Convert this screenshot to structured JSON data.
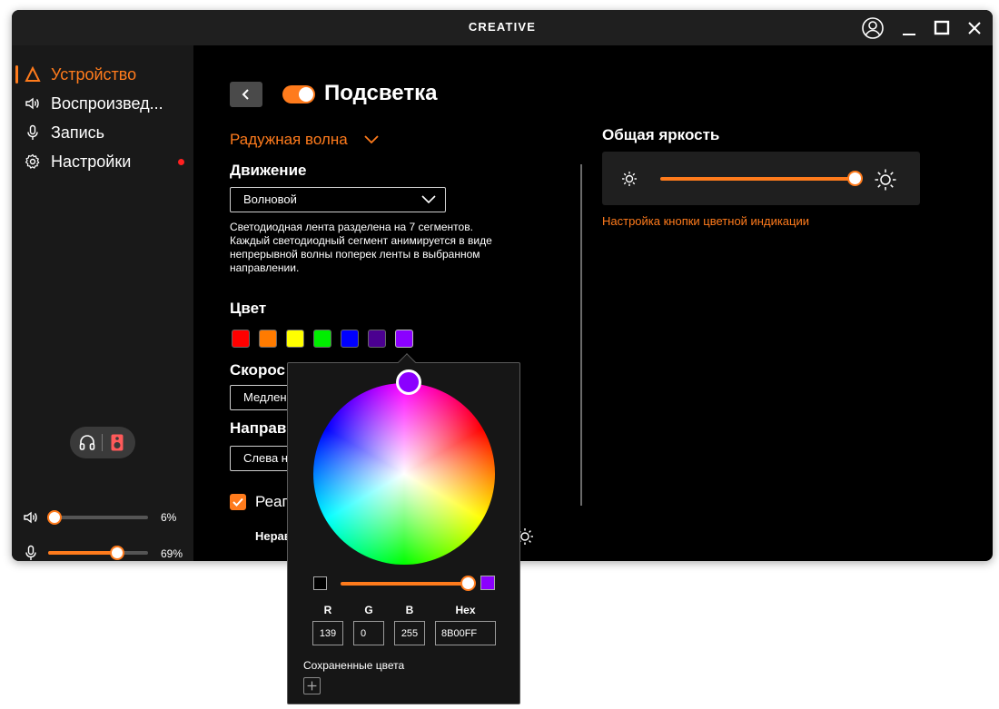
{
  "app": {
    "brand": "CREATIVE"
  },
  "sidebar": {
    "items": [
      {
        "label": "Устройство",
        "icon": "device-icon",
        "active": true
      },
      {
        "label": "Воспроизвед...",
        "icon": "speaker-icon",
        "active": false
      },
      {
        "label": "Запись",
        "icon": "microphone-icon",
        "active": false
      },
      {
        "label": "Настройки",
        "icon": "gear-icon",
        "active": false,
        "notification": true
      }
    ],
    "volume": {
      "value_label": "6%",
      "level": 0.06
    },
    "mic": {
      "value_label": "69%",
      "level": 0.69
    }
  },
  "main": {
    "title": "Подсветка",
    "lighting_enabled": true,
    "effect": "Радужная волна",
    "motion_label": "Движение",
    "motion_value": "Волновой",
    "description": "Светодиодная лента разделена на 7 сегментов. Каждый светодиодный сегмент анимируется в виде непрерывной волны поперек ленты в выбранном направлении.",
    "color_label": "Цвет",
    "colors": [
      "#ff0000",
      "#ff7b00",
      "#ffff00",
      "#00ee00",
      "#0000ff",
      "#4b0090",
      "#8b00ff"
    ],
    "speed_label": "Скорос",
    "speed_value": "Медлен",
    "direction_label": "Направ",
    "direction_value": "Слева н",
    "checkbox_label": "Реаг",
    "checkbox_checked": true,
    "small_label": "Нерав"
  },
  "brightness": {
    "title": "Общая яркость",
    "level": 1.0,
    "link": "Настройка кнопки цветной индикации"
  },
  "picker": {
    "selected_color": "#8b00ff",
    "labels": {
      "r": "R",
      "g": "G",
      "b": "B",
      "hex": "Hex"
    },
    "values": {
      "r": "139",
      "g": "0",
      "b": "255",
      "hex": "8B00FF"
    },
    "saved_label": "Сохраненные цвета"
  },
  "colors": {
    "accent": "#ff7b1c",
    "window_bg": "#000000",
    "sidebar_bg": "#191919"
  }
}
